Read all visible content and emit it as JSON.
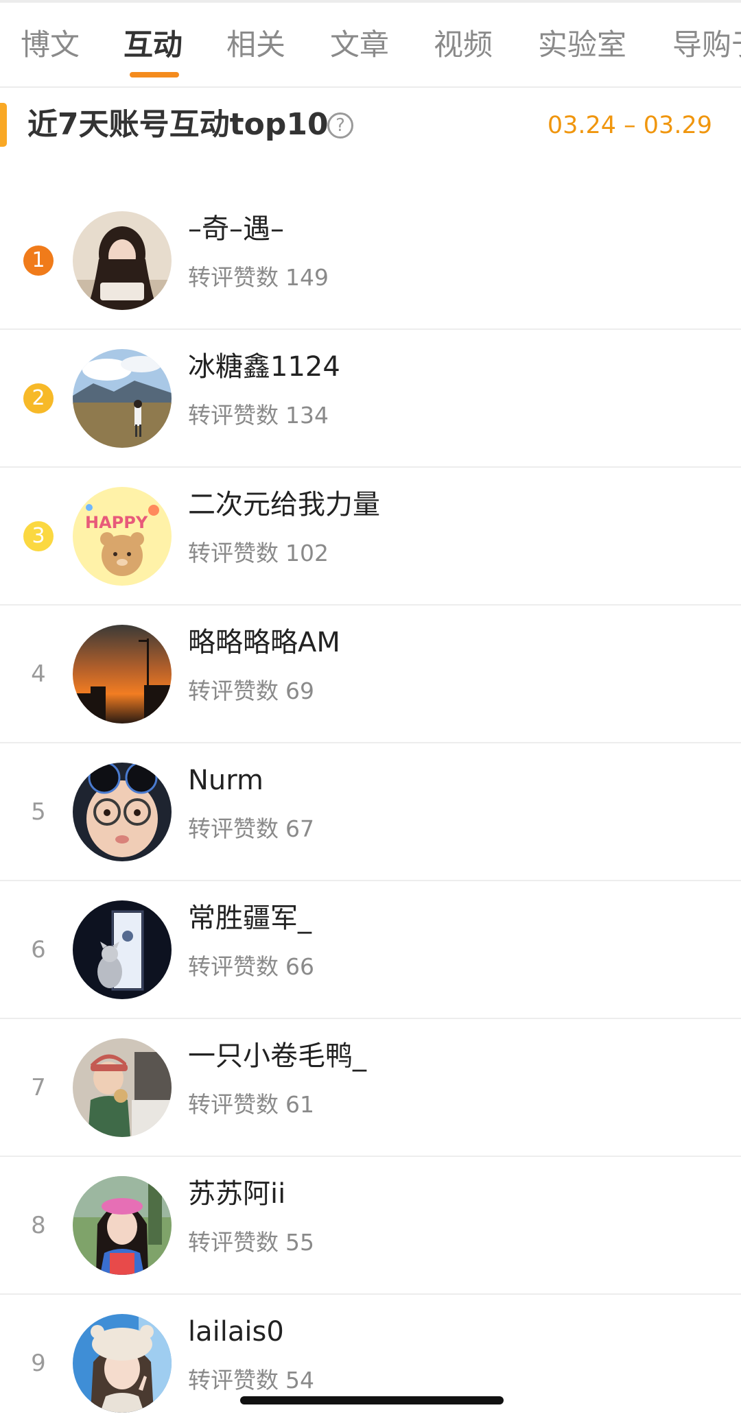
{
  "tabs": [
    {
      "label": "博文",
      "active": false
    },
    {
      "label": "互动",
      "active": true
    },
    {
      "label": "相关",
      "active": false
    },
    {
      "label": "文章",
      "active": false
    },
    {
      "label": "视频",
      "active": false
    },
    {
      "label": "实验室",
      "active": false
    },
    {
      "label": "导购于",
      "active": false
    }
  ],
  "section": {
    "title": "近7天账号互动top10",
    "help_icon": "question-circle-icon",
    "date_range": "03.24 – 03.29"
  },
  "colors": {
    "accent": "#f48b1d",
    "rank_1": "#f07b1a",
    "rank_2": "#f7b928",
    "rank_3": "#fbd841",
    "date": "#f0960e"
  },
  "ranking": [
    {
      "rank": "1",
      "name": "–奇–遇–",
      "stat_label": "转评赞数",
      "stat_value": "149"
    },
    {
      "rank": "2",
      "name": "冰糖鑫1124",
      "stat_label": "转评赞数",
      "stat_value": "134"
    },
    {
      "rank": "3",
      "name": "二次元给我力量",
      "stat_label": "转评赞数",
      "stat_value": "102"
    },
    {
      "rank": "4",
      "name": "略略略略AM",
      "stat_label": "转评赞数",
      "stat_value": "69"
    },
    {
      "rank": "5",
      "name": "Nurm",
      "stat_label": "转评赞数",
      "stat_value": "67"
    },
    {
      "rank": "6",
      "name": "常胜疆军_",
      "stat_label": "转评赞数",
      "stat_value": "66"
    },
    {
      "rank": "7",
      "name": "一只小卷毛鸭_",
      "stat_label": "转评赞数",
      "stat_value": "61"
    },
    {
      "rank": "8",
      "name": "苏苏阿ii",
      "stat_label": "转评赞数",
      "stat_value": "55"
    },
    {
      "rank": "9",
      "name": "lailais0",
      "stat_label": "转评赞数",
      "stat_value": "54"
    }
  ]
}
